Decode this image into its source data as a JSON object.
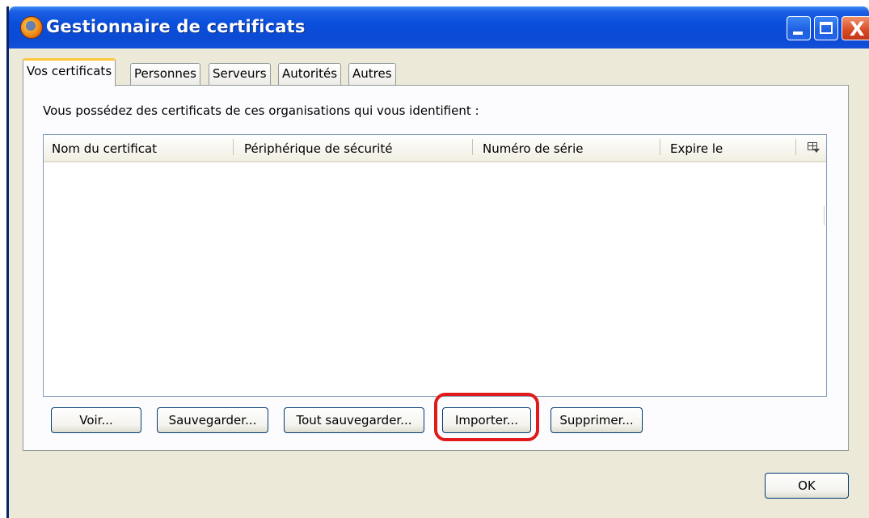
{
  "window": {
    "title": "Gestionnaire de certificats"
  },
  "title_buttons": {
    "close": "X"
  },
  "tabs": [
    {
      "label": "Vos certificats",
      "active": true
    },
    {
      "label": "Personnes"
    },
    {
      "label": "Serveurs"
    },
    {
      "label": "Autorités"
    },
    {
      "label": "Autres"
    }
  ],
  "panel": {
    "description": "Vous possédez des certificats de ces organisations qui vous identifient :",
    "columns": [
      "Nom du certificat",
      "Périphérique de sécurité",
      "Numéro de série",
      "Expire le"
    ],
    "rows": []
  },
  "buttons": {
    "view": "Voir...",
    "backup": "Sauvegarder...",
    "backup_all": "Tout sauvegarder...",
    "import": "Importer...",
    "delete": "Supprimer..."
  },
  "dialog": {
    "ok": "OK"
  },
  "colors": {
    "titlebar": "#0a4fdc",
    "highlight": "#e01a1a",
    "tab_active_accent": "#ffc83c"
  }
}
